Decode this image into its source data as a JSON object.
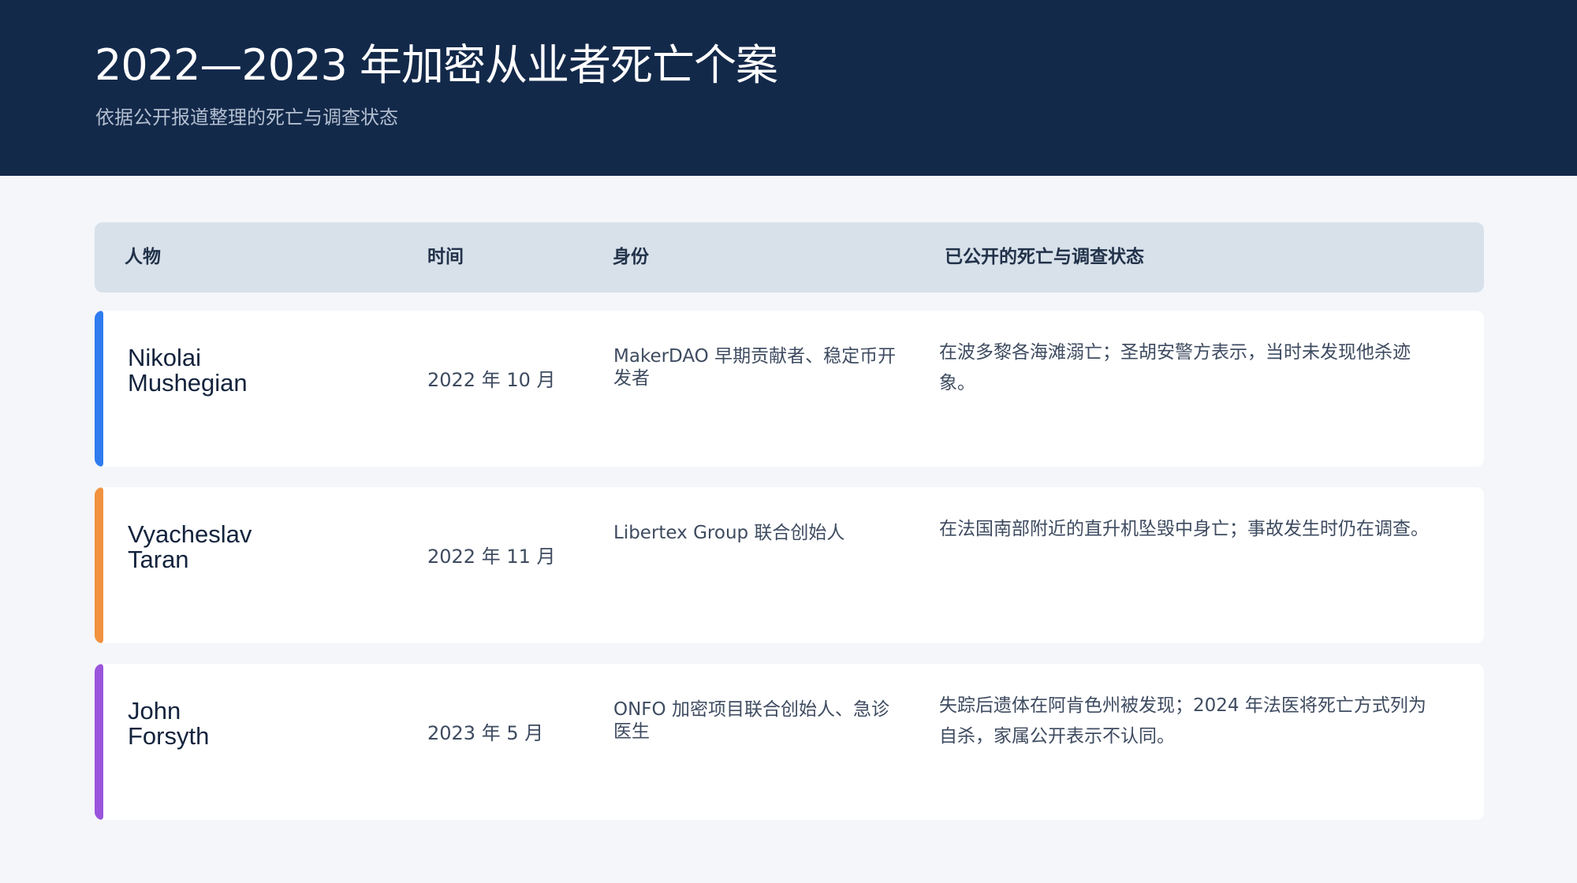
{
  "header": {
    "title": "2022—2023 年加密从业者死亡个案",
    "subtitle": "依据公开报道整理的死亡与调查状态"
  },
  "table": {
    "columns": [
      "人物",
      "时间",
      "身份",
      "已公开的死亡与调查状态"
    ],
    "rows": [
      {
        "name_line1": "Nikolai",
        "name_line2": "Mushegian",
        "time": "2022 年 10 月",
        "role": "MakerDAO 早期贡献者、稳定币开发者",
        "status": "在波多黎各海滩溺亡；圣胡安警方表示，当时未发现他杀迹象。",
        "accent": "#2f7cf0"
      },
      {
        "name_line1": "Vyacheslav",
        "name_line2": "Taran",
        "time": "2022 年 11 月",
        "role": "Libertex Group 联合创始人",
        "status": "在法国南部附近的直升机坠毁中身亡；事故发生时仍在调查。",
        "accent": "#f0923f"
      },
      {
        "name_line1": "John",
        "name_line2": "Forsyth",
        "time": "2023 年 5 月",
        "role": "ONFO 加密项目联合创始人、急诊医生",
        "status": "失踪后遗体在阿肯色州被发现；2024 年法医将死亡方式列为自杀，家属公开表示不认同。",
        "accent": "#9a55dc"
      }
    ]
  }
}
